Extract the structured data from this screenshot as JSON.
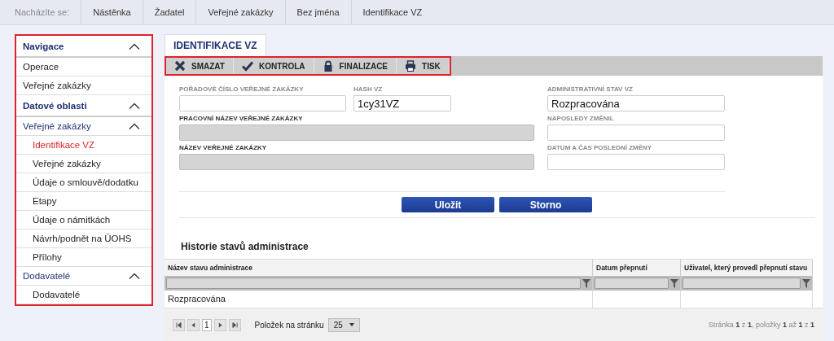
{
  "breadcrumb": {
    "label": "Nacházíte se:",
    "items": [
      "Nástěnka",
      "Žadatel",
      "Veřejné zakázky",
      "Bez jména",
      "Identifikace VZ"
    ]
  },
  "sidebar": {
    "items": [
      {
        "label": "Navigace",
        "kind": "section",
        "expanded": true,
        "children": [
          {
            "label": "Operace",
            "kind": "link",
            "selected": false
          },
          {
            "label": "Veřejné zakázky",
            "kind": "link",
            "selected": false
          }
        ]
      },
      {
        "label": "Datové oblasti",
        "kind": "section",
        "expanded": true,
        "children": [
          {
            "label": "Veřejné zakázky",
            "kind": "subsection",
            "expanded": true,
            "children": [
              {
                "label": "Identifikace VZ",
                "kind": "link",
                "selected": true
              },
              {
                "label": "Veřejné zakázky",
                "kind": "link",
                "selected": false
              },
              {
                "label": "Údaje o smlouvě/dodatku",
                "kind": "link",
                "selected": false
              },
              {
                "label": "Etapy",
                "kind": "link",
                "selected": false
              },
              {
                "label": "Údaje o námitkách",
                "kind": "link",
                "selected": false
              },
              {
                "label": "Návrh/podnět na ÚOHS",
                "kind": "link",
                "selected": false
              },
              {
                "label": "Přílohy",
                "kind": "link",
                "selected": false
              }
            ]
          },
          {
            "label": "Dodavatelé",
            "kind": "subsection",
            "expanded": true,
            "children": [
              {
                "label": "Dodavatelé",
                "kind": "link",
                "selected": false
              }
            ]
          }
        ]
      }
    ]
  },
  "tab": {
    "label": "IDENTIFIKACE VZ",
    "selected": true
  },
  "toolbar": [
    "SMAZAT",
    "KONTROLA",
    "FINALIZACE",
    "TISK"
  ],
  "form": {
    "left": [
      {
        "label": "POŘADOVÉ ČÍSLO VEŘEJNÉ ZAKÁZKY",
        "disabled": false,
        "required": false
      },
      {
        "label": "HASH VZ",
        "value": "1cy31VZ",
        "disabled": false,
        "required": false
      },
      {
        "label": "PRACOVNÍ NÁZEV VEŘEJNÉ ZAKÁZKY",
        "disabled": true,
        "required": true
      },
      {
        "label": "NÁZEV VEŘEJNÉ ZAKÁZKY",
        "disabled": true,
        "required": true
      }
    ],
    "right": [
      {
        "label": "ADMINISTRATIVNÍ STAV VZ",
        "value": "Rozpracována",
        "disabled": false,
        "required": false
      },
      {
        "label": "NAPOSLEDY ZMĚNIL",
        "disabled": false,
        "required": false
      },
      {
        "label": "DATUM A ČAS POSLEDNÍ ZMĚNY",
        "disabled": false,
        "required": false
      }
    ]
  },
  "buttons": [
    "Uložit",
    "Storno"
  ],
  "history": {
    "title": "Historie stavů administrace",
    "columns": [
      "Název stavu administrace",
      "Datum přepnutí",
      "Uživatel, který provedl přepnutí stavu"
    ],
    "rows": [
      [
        "Rozpracována",
        "",
        ""
      ]
    ],
    "pager": {
      "page": "1",
      "page_size_label": "Položek na stránku",
      "page_size": "25",
      "summary": "Stránka **1** z **1**, položky **1** až **1** z **1**"
    }
  }
}
